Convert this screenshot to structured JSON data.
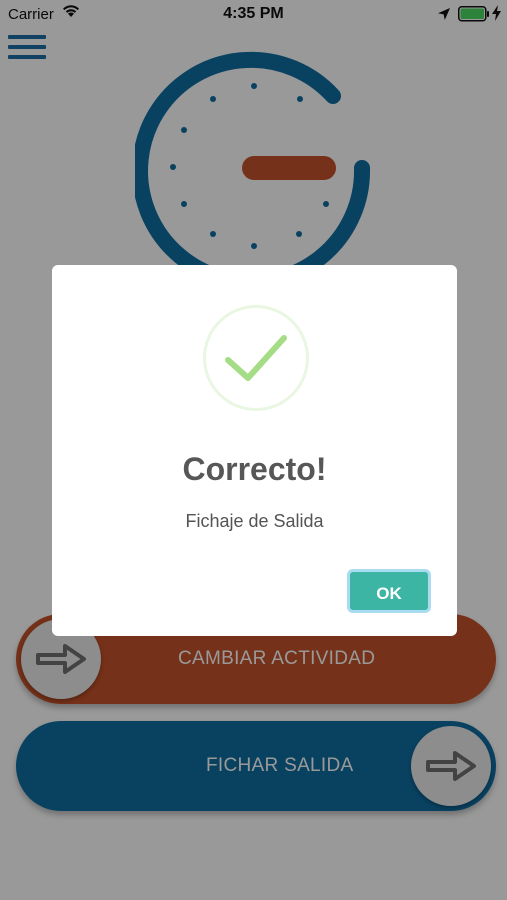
{
  "status_bar": {
    "carrier": "Carrier",
    "time": "4:35 PM",
    "icons": [
      "wifi-icon",
      "location-arrow-icon",
      "battery-icon",
      "charging-bolt-icon"
    ],
    "battery_color": "#4cd964"
  },
  "header": {
    "menu_icon": "hamburger-menu-icon",
    "logo_icon": "clock-g-logo-icon"
  },
  "actions": {
    "change_activity_label": "CAMBIAR ACTIVIDAD",
    "clock_out_label": "FICHAR SALIDA",
    "knob_icon": "arrow-right-icon"
  },
  "dialog": {
    "icon": "checkmark-icon",
    "title": "Correcto!",
    "message": "Fichaje de Salida",
    "ok_label": "OK"
  },
  "colors": {
    "primary_blue": "#0f6ea1",
    "accent_orange": "#c4522a",
    "ok_button": "#3cb5a5",
    "success_green": "#a5dc86",
    "overlay": "rgba(0,0,0,0.4)"
  }
}
